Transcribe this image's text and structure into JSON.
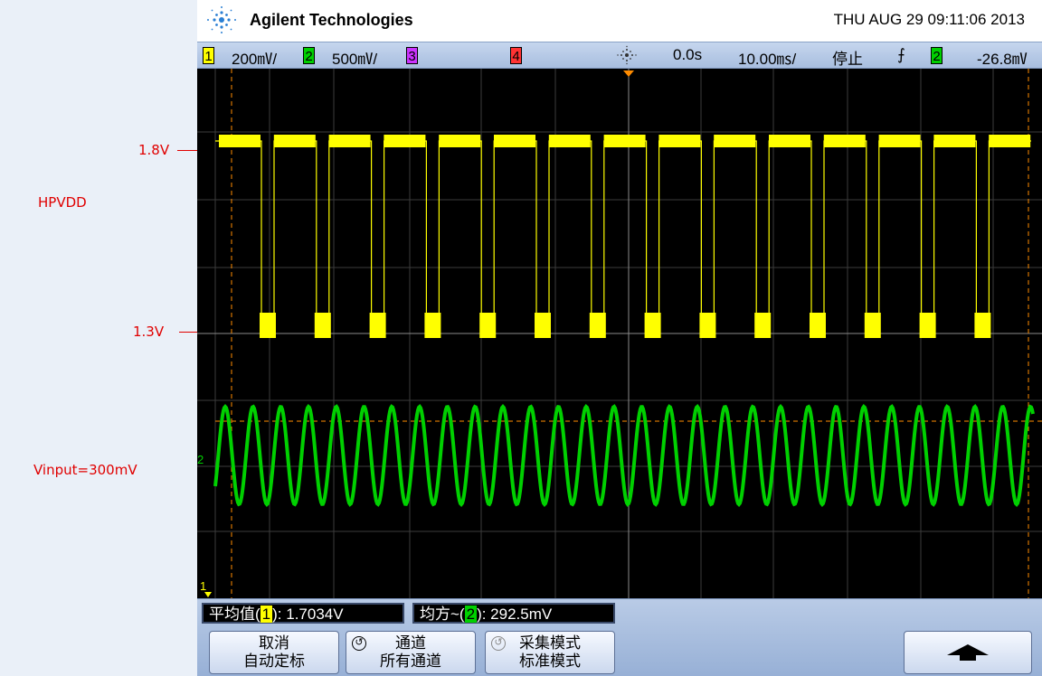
{
  "annotations": {
    "v_high": "1.8V",
    "v_low": "1.3V",
    "hpvdd": "HPVDD",
    "vinput": "Vinput=300mV"
  },
  "header": {
    "brand": "Agilent Technologies",
    "datetime": "THU AUG 29 09:11:06 2013"
  },
  "status": {
    "ch1_num": "1",
    "ch1_scale": "200㎷/",
    "ch2_num": "2",
    "ch2_scale": "500㎷/",
    "ch3_num": "3",
    "ch4_num": "4",
    "delay": "0.0s",
    "timebase": "10.00㎳/",
    "run_state": "停止",
    "trigger_slope": "⨍",
    "trigger_source": "2",
    "trigger_level": "-26.8㎷"
  },
  "markers": {
    "ch2_marker": "2",
    "ch1_marker": "1"
  },
  "measurements": {
    "m1_prefix": "平均值(",
    "m1_ch": "1",
    "m1_suffix": "): 1.7034V",
    "m2_prefix": "均方~(",
    "m2_ch": "2",
    "m2_suffix": "): 292.5mV"
  },
  "softkeys": [
    {
      "line1": "取消",
      "line2": "自动定标"
    },
    {
      "line1": "通道",
      "line2": "所有通道"
    },
    {
      "line1": "采集模式",
      "line2": "标准模式"
    },
    {
      "icon": "up-arrow-icon"
    }
  ],
  "colors": {
    "ch1": "#ffff00",
    "ch2": "#00d000",
    "ch3": "#cc33ff",
    "ch4": "#ff3333",
    "annotation": "#e00000",
    "cursor": "#ff8c00"
  }
}
